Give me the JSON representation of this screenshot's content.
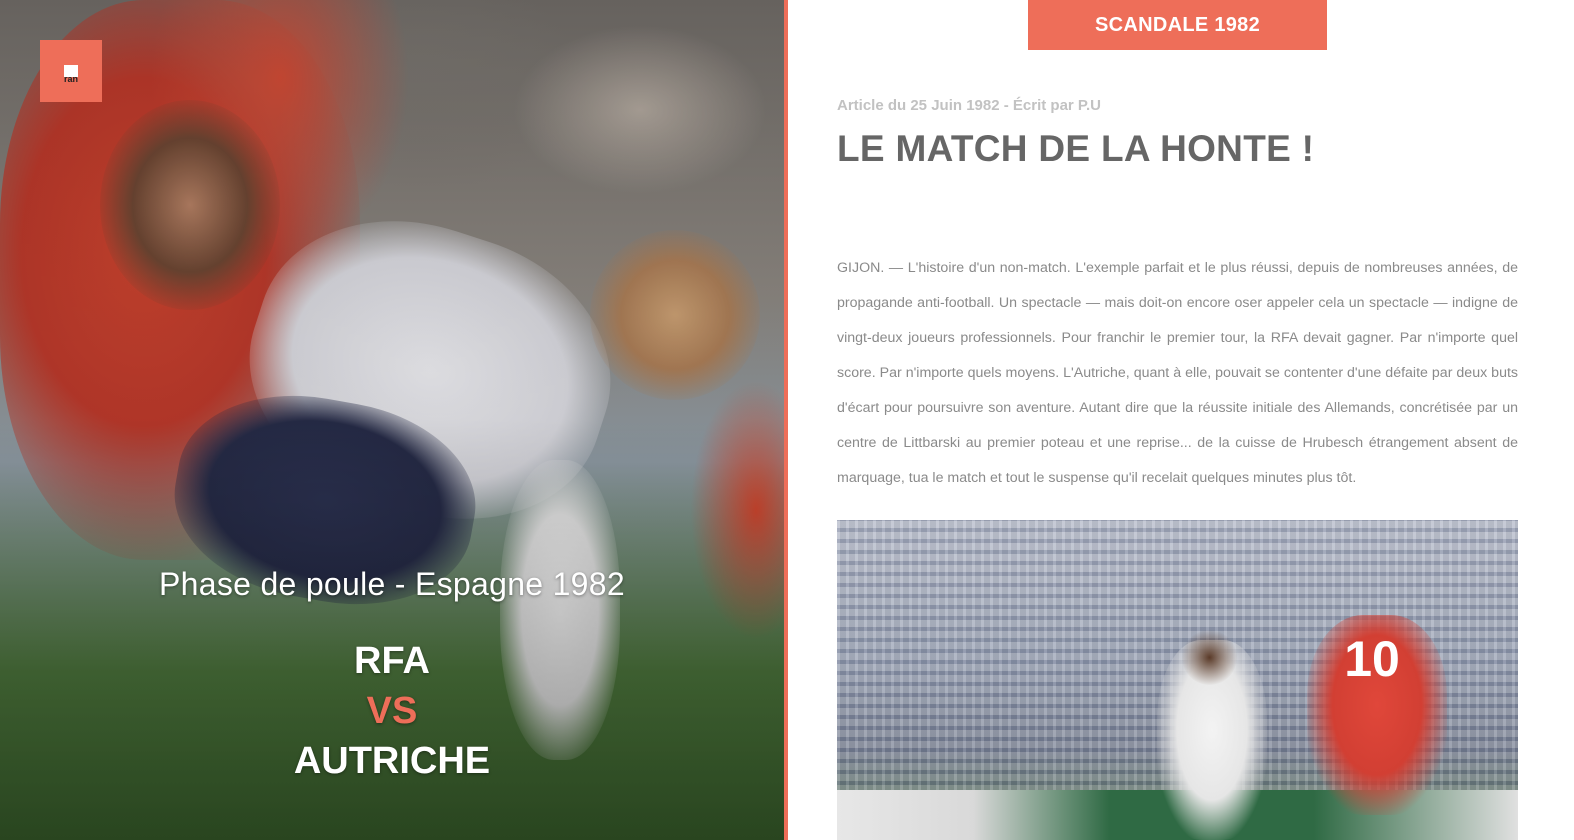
{
  "hero": {
    "badge_text": "ran",
    "phase": "Phase de poule - Espagne 1982",
    "team1": "RFA",
    "vs": "VS",
    "team2": "AUTRICHE"
  },
  "article": {
    "tag": "SCANDALE 1982",
    "meta": "Article du 25 Juin 1982 - Écrit par P.U",
    "title": "LE MATCH DE LA HONTE !",
    "body": "GIJON. — L'histoire d'un non-match. L'exemple parfait et le plus réussi, depuis de nombreuses années, de propagande anti-football. Un spectacle — mais doit-on encore oser appeler cela un spectacle — indigne de vingt-deux joueurs professionnels. Pour franchir le premier tour, la RFA devait gagner. Par n'importe quel score. Par n'importe quels moyens. L'Autriche, quant à elle, pouvait se contenter d'une défaite par deux buts d'écart pour poursuivre son aventure. Autant dire que la réussite initiale des Allemands, concrétisée par un centre de Littbarski au premier poteau et une reprise... de la cuisse de Hrubesch étrangement absent de marquage, tua le match et tout le suspense qu'il recelait quelques minutes plus tôt.",
    "photo_number": "10"
  },
  "colors": {
    "accent": "#ee6e59",
    "title": "#666666",
    "meta": "#c2c2c2",
    "body": "#8a8a8a"
  }
}
